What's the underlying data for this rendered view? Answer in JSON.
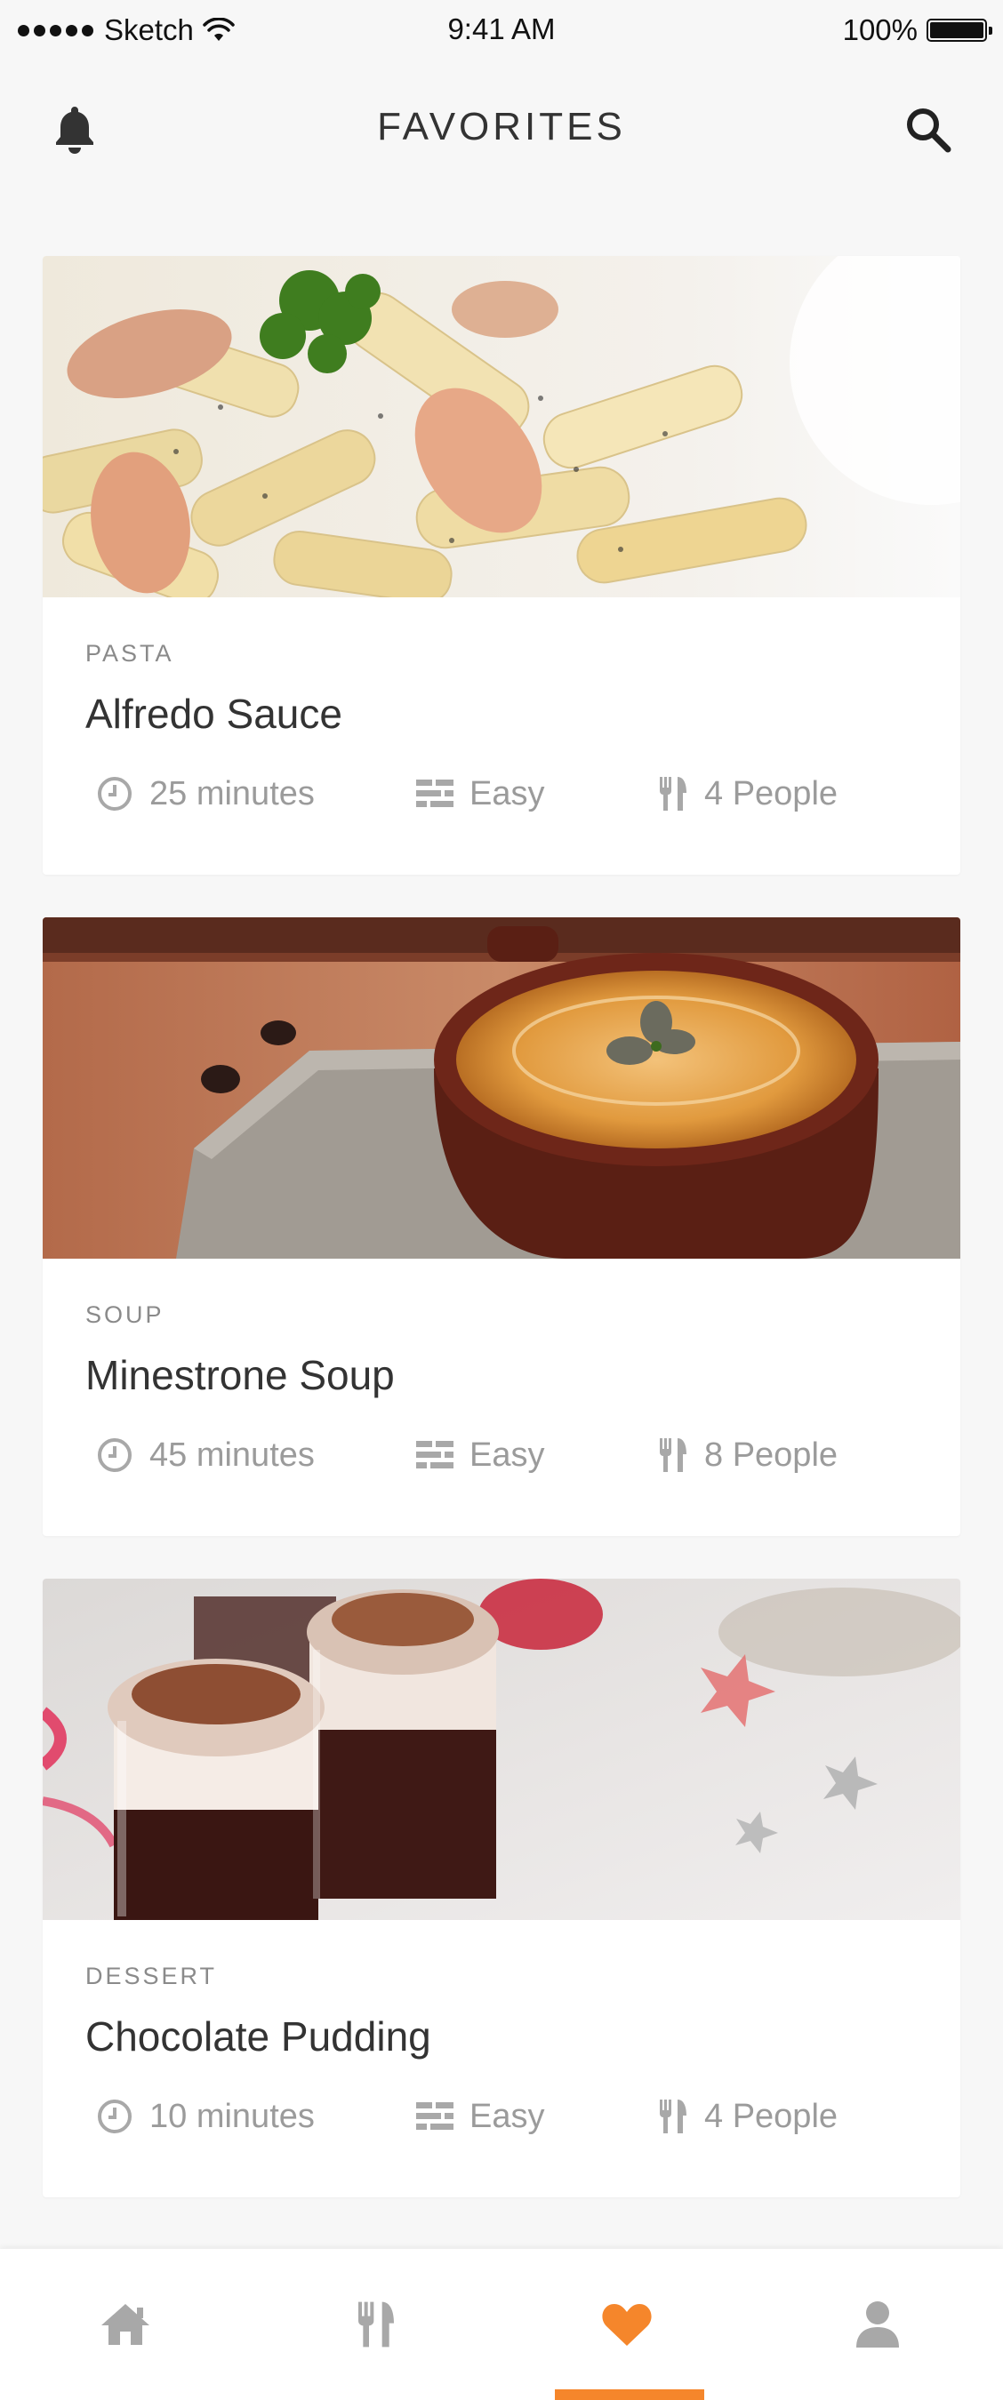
{
  "status_bar": {
    "carrier": "Sketch",
    "time": "9:41 AM",
    "battery": "100%"
  },
  "header": {
    "title": "FAVORITES",
    "left_icon": "bell-icon",
    "right_icon": "search-icon"
  },
  "recipes": [
    {
      "category": "PASTA",
      "title": "Alfredo Sauce",
      "time": "25 minutes",
      "difficulty": "Easy",
      "servings": "4 People"
    },
    {
      "category": "SOUP",
      "title": "Minestrone Soup",
      "time": "45 minutes",
      "difficulty": "Easy",
      "servings": "8 People"
    },
    {
      "category": "DESSERT",
      "title": "Chocolate Pudding",
      "time": "10 minutes",
      "difficulty": "Easy",
      "servings": "4 People"
    }
  ],
  "tabbar": {
    "items": [
      "home-icon",
      "fork-knife-icon",
      "heart-icon",
      "person-icon"
    ],
    "active_index": 2
  },
  "colors": {
    "accent": "#f5862b",
    "background": "#f7f7f7",
    "icon_muted": "#a8a8a8",
    "text_muted": "#9b9b9b"
  }
}
